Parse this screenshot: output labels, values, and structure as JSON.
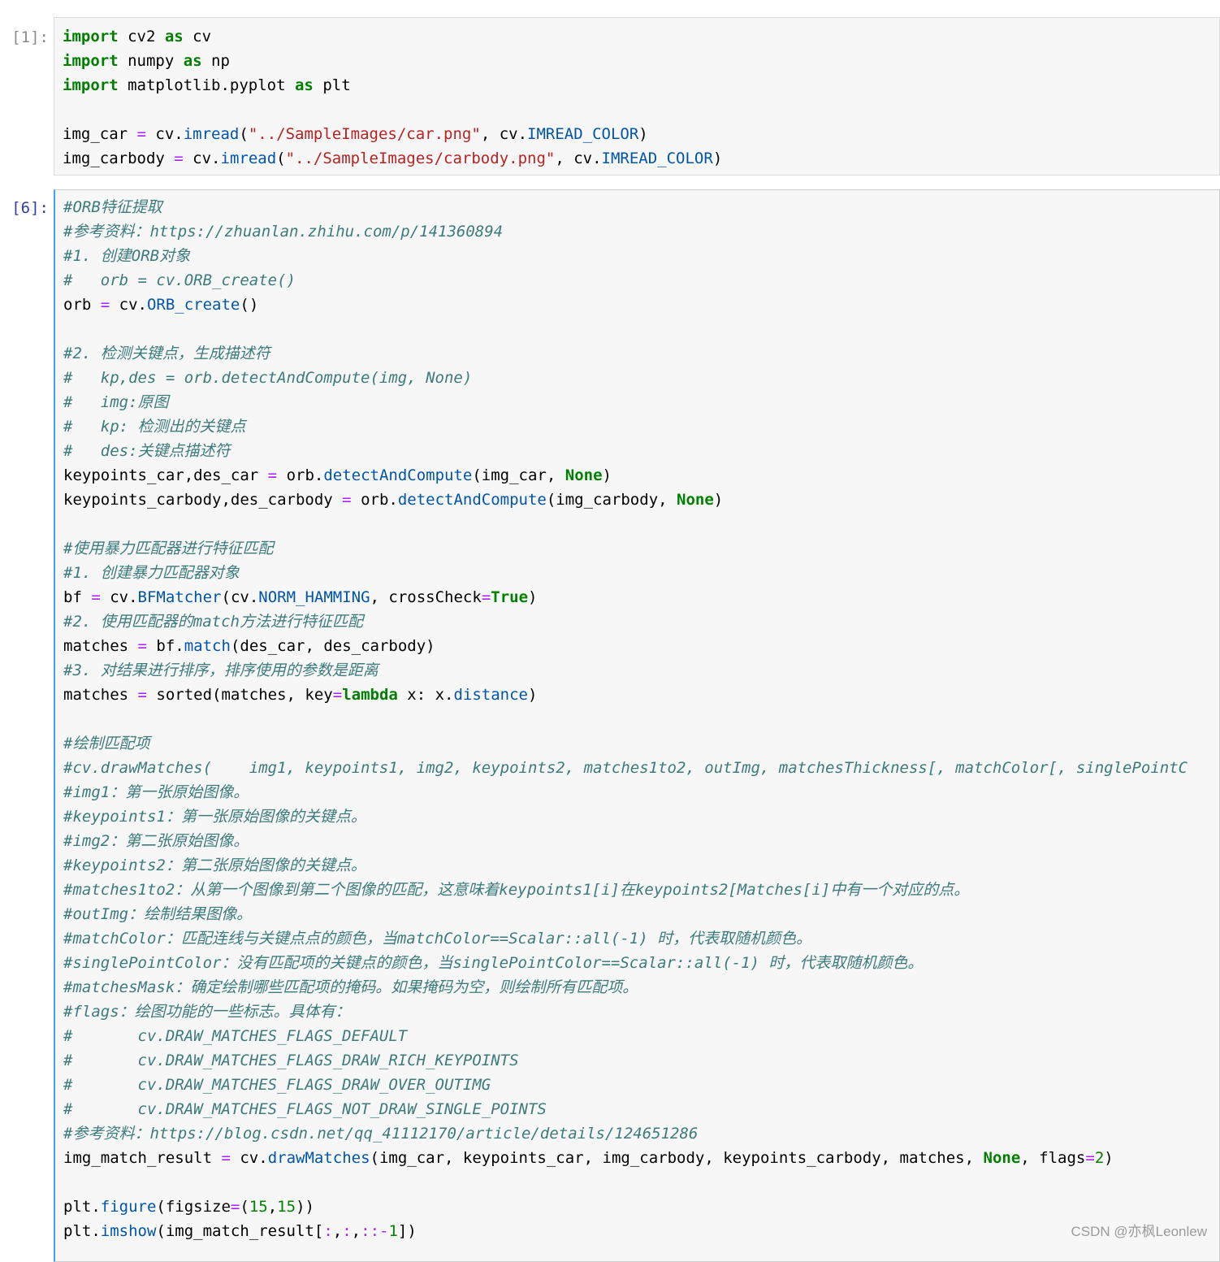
{
  "cells": [
    {
      "prompt": "[1]:",
      "selected": false,
      "lines": [
        [
          [
            "kw",
            "import"
          ],
          [
            "plain",
            " cv2 "
          ],
          [
            "kw",
            "as"
          ],
          [
            "plain",
            " cv"
          ]
        ],
        [
          [
            "kw",
            "import"
          ],
          [
            "plain",
            " numpy "
          ],
          [
            "kw",
            "as"
          ],
          [
            "plain",
            " np"
          ]
        ],
        [
          [
            "kw",
            "import"
          ],
          [
            "plain",
            " matplotlib.pyplot "
          ],
          [
            "kw",
            "as"
          ],
          [
            "plain",
            " plt"
          ]
        ],
        [],
        [
          [
            "plain",
            "img_car "
          ],
          [
            "op",
            "="
          ],
          [
            "plain",
            " cv."
          ],
          [
            "attr",
            "imread"
          ],
          [
            "plain",
            "("
          ],
          [
            "str",
            "\"../SampleImages/car.png\""
          ],
          [
            "plain",
            ", cv."
          ],
          [
            "attr",
            "IMREAD_COLOR"
          ],
          [
            "plain",
            ")"
          ]
        ],
        [
          [
            "plain",
            "img_carbody "
          ],
          [
            "op",
            "="
          ],
          [
            "plain",
            " cv."
          ],
          [
            "attr",
            "imread"
          ],
          [
            "plain",
            "("
          ],
          [
            "str",
            "\"../SampleImages/carbody.png\""
          ],
          [
            "plain",
            ", cv."
          ],
          [
            "attr",
            "IMREAD_COLOR"
          ],
          [
            "plain",
            ")"
          ]
        ]
      ]
    },
    {
      "prompt": "[6]:",
      "selected": true,
      "lines": [
        [
          [
            "cmt",
            "#ORB特征提取"
          ]
        ],
        [
          [
            "cmt",
            "#参考资料：https://zhuanlan.zhihu.com/p/141360894"
          ]
        ],
        [
          [
            "cmt",
            "#1. 创建ORB对象"
          ]
        ],
        [
          [
            "cmt",
            "#   orb = cv.ORB_create()"
          ]
        ],
        [
          [
            "plain",
            "orb "
          ],
          [
            "op",
            "="
          ],
          [
            "plain",
            " cv."
          ],
          [
            "attr",
            "ORB_create"
          ],
          [
            "plain",
            "()"
          ]
        ],
        [],
        [
          [
            "cmt",
            "#2. 检测关键点，生成描述符"
          ]
        ],
        [
          [
            "cmt",
            "#   kp,des = orb.detectAndCompute(img, None)"
          ]
        ],
        [
          [
            "cmt",
            "#   img:原图"
          ]
        ],
        [
          [
            "cmt",
            "#   kp: 检测出的关键点"
          ]
        ],
        [
          [
            "cmt",
            "#   des:关键点描述符"
          ]
        ],
        [
          [
            "plain",
            "keypoints_car,des_car "
          ],
          [
            "op",
            "="
          ],
          [
            "plain",
            " orb."
          ],
          [
            "attr",
            "detectAndCompute"
          ],
          [
            "plain",
            "(img_car, "
          ],
          [
            "kw",
            "None"
          ],
          [
            "plain",
            ")"
          ]
        ],
        [
          [
            "plain",
            "keypoints_carbody,des_carbody "
          ],
          [
            "op",
            "="
          ],
          [
            "plain",
            " orb."
          ],
          [
            "attr",
            "detectAndCompute"
          ],
          [
            "plain",
            "(img_carbody, "
          ],
          [
            "kw",
            "None"
          ],
          [
            "plain",
            ")"
          ]
        ],
        [],
        [
          [
            "cmt",
            "#使用暴力匹配器进行特征匹配"
          ]
        ],
        [
          [
            "cmt",
            "#1. 创建暴力匹配器对象"
          ]
        ],
        [
          [
            "plain",
            "bf "
          ],
          [
            "op",
            "="
          ],
          [
            "plain",
            " cv."
          ],
          [
            "attr",
            "BFMatcher"
          ],
          [
            "plain",
            "(cv."
          ],
          [
            "attr",
            "NORM_HAMMING"
          ],
          [
            "plain",
            ", crossCheck"
          ],
          [
            "op",
            "="
          ],
          [
            "kw",
            "True"
          ],
          [
            "plain",
            ")"
          ]
        ],
        [
          [
            "cmt",
            "#2. 使用匹配器的match方法进行特征匹配"
          ]
        ],
        [
          [
            "plain",
            "matches "
          ],
          [
            "op",
            "="
          ],
          [
            "plain",
            " bf."
          ],
          [
            "attr",
            "match"
          ],
          [
            "plain",
            "(des_car, des_carbody)"
          ]
        ],
        [
          [
            "cmt",
            "#3. 对结果进行排序，排序使用的参数是距离"
          ]
        ],
        [
          [
            "plain",
            "matches "
          ],
          [
            "op",
            "="
          ],
          [
            "plain",
            " sorted(matches, key"
          ],
          [
            "op",
            "="
          ],
          [
            "kw",
            "lambda"
          ],
          [
            "plain",
            " x: x."
          ],
          [
            "attr",
            "distance"
          ],
          [
            "plain",
            ")"
          ]
        ],
        [],
        [
          [
            "cmt",
            "#绘制匹配项"
          ]
        ],
        [
          [
            "cmt",
            "#cv.drawMatches(    img1, keypoints1, img2, keypoints2, matches1to2, outImg, matchesThickness[, matchColor[, singlePointC"
          ]
        ],
        [
          [
            "cmt",
            "#img1：第一张原始图像。"
          ]
        ],
        [
          [
            "cmt",
            "#keypoints1：第一张原始图像的关键点。"
          ]
        ],
        [
          [
            "cmt",
            "#img2：第二张原始图像。"
          ]
        ],
        [
          [
            "cmt",
            "#keypoints2：第二张原始图像的关键点。"
          ]
        ],
        [
          [
            "cmt",
            "#matches1to2：从第一个图像到第二个图像的匹配，这意味着keypoints1[i]在keypoints2[Matches[i]中有一个对应的点。"
          ]
        ],
        [
          [
            "cmt",
            "#outImg：绘制结果图像。"
          ]
        ],
        [
          [
            "cmt",
            "#matchColor：匹配连线与关键点点的颜色，当matchColor==Scalar::all(-1) 时，代表取随机颜色。"
          ]
        ],
        [
          [
            "cmt",
            "#singlePointColor：没有匹配项的关键点的颜色，当singlePointColor==Scalar::all(-1) 时，代表取随机颜色。"
          ]
        ],
        [
          [
            "cmt",
            "#matchesMask：确定绘制哪些匹配项的掩码。如果掩码为空，则绘制所有匹配项。"
          ]
        ],
        [
          [
            "cmt",
            "#flags：绘图功能的一些标志。具体有："
          ]
        ],
        [
          [
            "cmt",
            "#       cv.DRAW_MATCHES_FLAGS_DEFAULT"
          ]
        ],
        [
          [
            "cmt",
            "#       cv.DRAW_MATCHES_FLAGS_DRAW_RICH_KEYPOINTS"
          ]
        ],
        [
          [
            "cmt",
            "#       cv.DRAW_MATCHES_FLAGS_DRAW_OVER_OUTIMG"
          ]
        ],
        [
          [
            "cmt",
            "#       cv.DRAW_MATCHES_FLAGS_NOT_DRAW_SINGLE_POINTS"
          ]
        ],
        [
          [
            "cmt",
            "#参考资料：https://blog.csdn.net/qq_41112170/article/details/124651286"
          ]
        ],
        [
          [
            "plain",
            "img_match_result "
          ],
          [
            "op",
            "="
          ],
          [
            "plain",
            " cv."
          ],
          [
            "attr",
            "drawMatches"
          ],
          [
            "plain",
            "(img_car, keypoints_car, img_carbody, keypoints_carbody, matches, "
          ],
          [
            "kw",
            "None"
          ],
          [
            "plain",
            ", flags"
          ],
          [
            "op",
            "="
          ],
          [
            "num",
            "2"
          ],
          [
            "plain",
            ")"
          ]
        ],
        [],
        [
          [
            "plain",
            "plt."
          ],
          [
            "attr",
            "figure"
          ],
          [
            "plain",
            "(figsize"
          ],
          [
            "op",
            "="
          ],
          [
            "plain",
            "("
          ],
          [
            "num",
            "15"
          ],
          [
            "plain",
            ","
          ],
          [
            "num",
            "15"
          ],
          [
            "plain",
            "))"
          ]
        ],
        [
          [
            "plain",
            "plt."
          ],
          [
            "attr",
            "imshow"
          ],
          [
            "plain",
            "(img_match_result["
          ],
          [
            "op",
            ":"
          ],
          [
            "plain",
            ","
          ],
          [
            "op",
            ":"
          ],
          [
            "plain",
            ","
          ],
          [
            "op",
            "::-"
          ],
          [
            "num",
            "1"
          ],
          [
            "plain",
            "])"
          ]
        ]
      ]
    }
  ],
  "watermark": "CSDN @亦枫Leonlew",
  "colors": {
    "keyword": "#008000",
    "string": "#ba2121",
    "operator": "#aa22ff",
    "attribute": "#0055aa",
    "comment": "#3d7b7b",
    "prompt_active": "#303f9f",
    "prompt_idle": "#8c8c8c",
    "selection_bar": "#42a5f5"
  }
}
